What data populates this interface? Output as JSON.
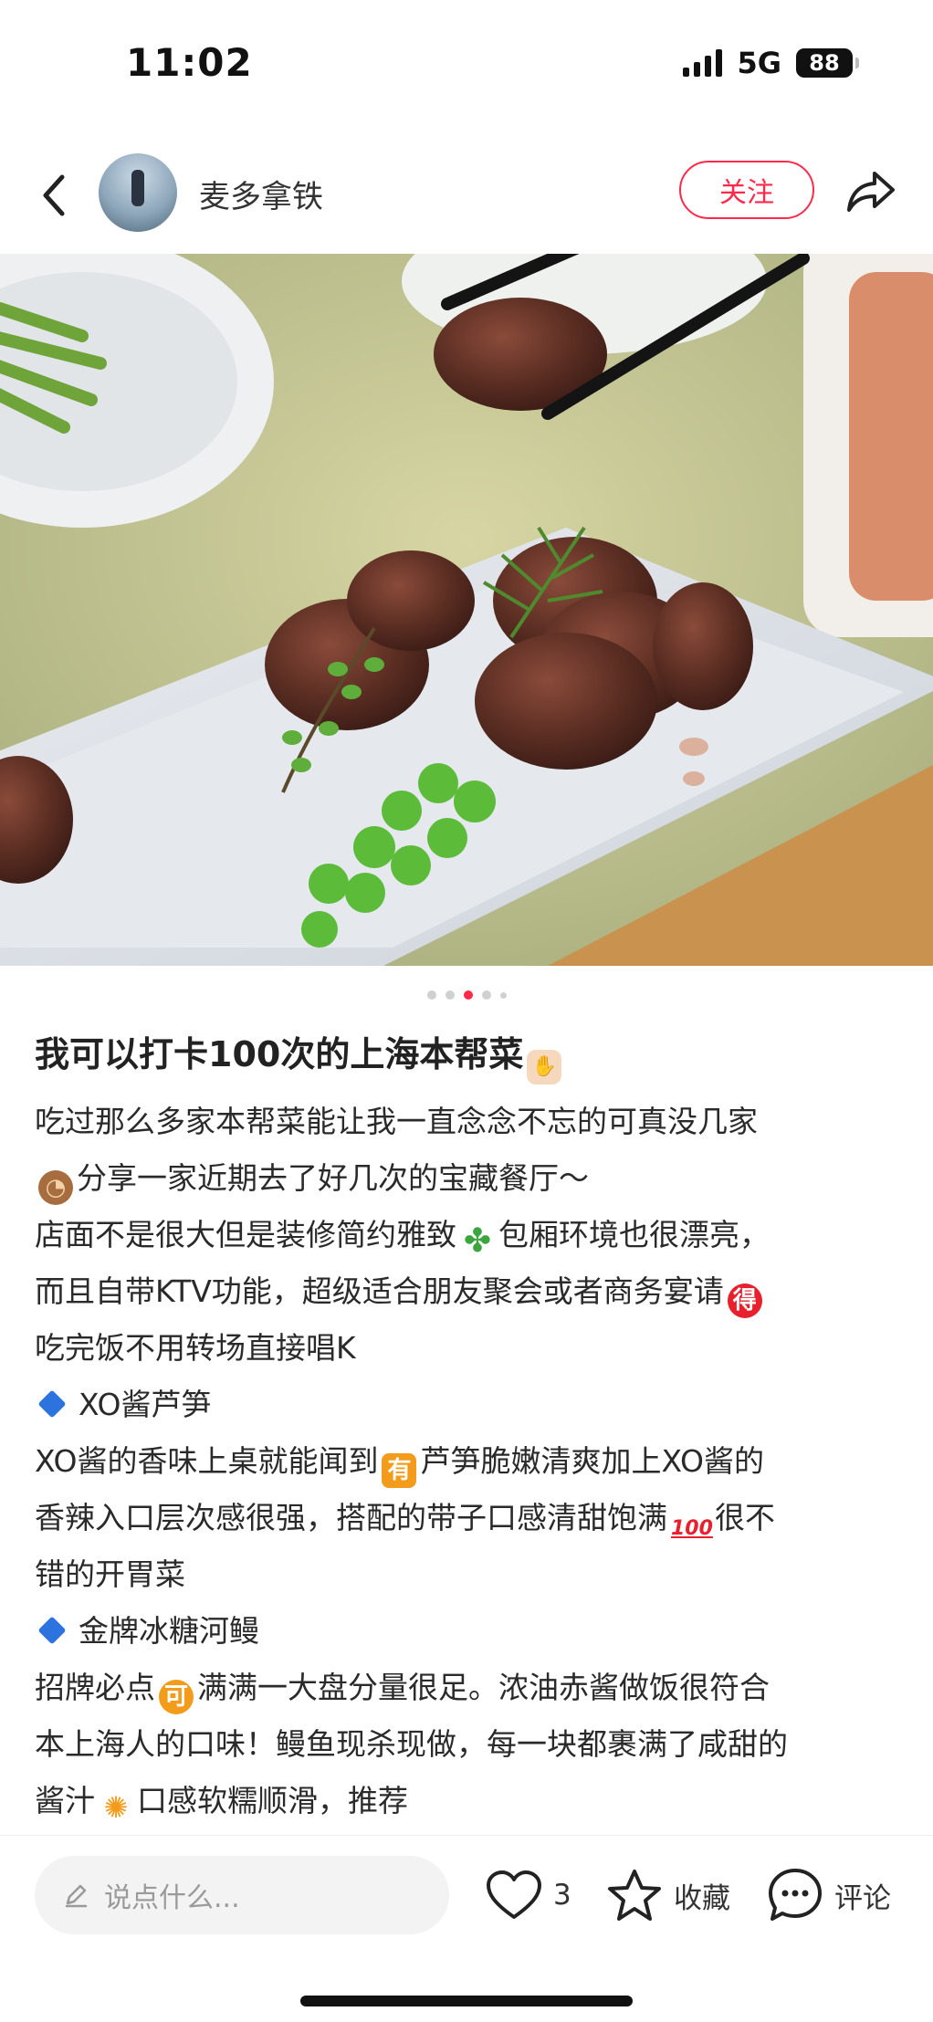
{
  "status_bar": {
    "time": "11:02",
    "network": "5G",
    "battery": "88"
  },
  "header": {
    "author_name": "麦多拿铁",
    "follow_label": "关注"
  },
  "photo": {
    "pagination": {
      "total": 5,
      "active_index": 2
    }
  },
  "note": {
    "title": "我可以打卡100次的上海本帮菜",
    "paragraphs": {
      "p1": "吃过那么多家本帮菜能让我一直念念不忘的可真没几家",
      "p2": "分享一家近期去了好几次的宝藏餐厅～",
      "p3a": "店面不是很大但是装修简约雅致",
      "p3b": "包厢环境也很漂亮，",
      "p4": "而且自带KTV功能，超级适合朋友聚会或者商务宴请",
      "p5": "吃完饭不用转场直接唱K",
      "h1": "XO酱芦笋",
      "p6a": "XO酱的香味上桌就能闻到",
      "p6b": "芦笋脆嫩清爽加上XO酱的",
      "p7a": "香辣入口层次感很强，搭配的带子口感清甜饱满",
      "p7b": "很不",
      "p8": "错的开胃菜",
      "h2": "金牌冰糖河鳗",
      "p9a": "招牌必点",
      "p9b": "满满一大盘分量很足。浓油赤酱做饭很符合",
      "p10": "本上海人的口味！鳗鱼现杀现做，每一块都裹满了咸甜的",
      "p11a": "酱汁",
      "p11b": "口感软糯顺滑，推荐"
    },
    "badges": {
      "de": "得",
      "you": "有",
      "ke": "可",
      "hundred": "100"
    }
  },
  "bottom_bar": {
    "comment_placeholder": "说点什么...",
    "like_count": "3",
    "collect_label": "收藏",
    "comment_label": "评论"
  },
  "icons": {
    "back": "chevron-left-icon",
    "share": "share-arrow-icon",
    "pen": "pen-icon",
    "like": "heart-icon",
    "collect": "star-icon",
    "comment": "chat-bubble-icon"
  },
  "colors": {
    "accent": "#ff2a4a",
    "diamond": "#2d73e0"
  }
}
